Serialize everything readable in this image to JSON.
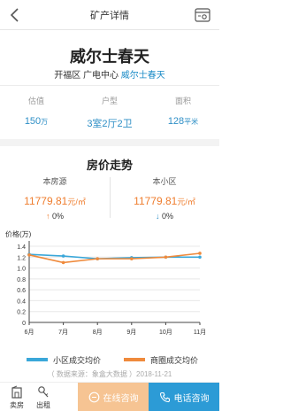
{
  "nav": {
    "title": "矿产详情"
  },
  "property": {
    "name": "威尔士春天",
    "location_prefix": "开福区 广电中心",
    "location_highlight": "威尔士春天"
  },
  "stats": [
    {
      "label": "估值",
      "value": "150",
      "unit": "万"
    },
    {
      "label": "户型",
      "value": "3室2厅2卫",
      "unit": ""
    },
    {
      "label": "面积",
      "value": "128",
      "unit": "平米"
    }
  ],
  "trend": {
    "title": "房价走势",
    "left": {
      "label": "本房源",
      "price": "11779.81",
      "unit": "元/㎡",
      "change": "0%",
      "direction": "up"
    },
    "right": {
      "label": "本小区",
      "price": "11779.81",
      "unit": "元/㎡",
      "change": "0%",
      "direction": "down"
    }
  },
  "chart_data": {
    "type": "line",
    "ylabel": "价格(万)",
    "x": [
      "6月",
      "7月",
      "8月",
      "9月",
      "10月",
      "11月"
    ],
    "ylim": [
      0,
      1.4
    ],
    "yticks": [
      "0",
      "0.2",
      "0.4",
      "0.6",
      "0.8",
      "1.0",
      "1.2",
      "1.4"
    ],
    "grid": true,
    "legend": "bottom",
    "series": [
      {
        "name": "小区成交均价",
        "color": "#3aa7d9",
        "values": [
          1.25,
          1.22,
          1.17,
          1.19,
          1.2,
          1.2
        ]
      },
      {
        "name": "商圈成交均价",
        "color": "#ef8a3c",
        "values": [
          1.24,
          1.1,
          1.17,
          1.17,
          1.2,
          1.27
        ]
      }
    ]
  },
  "source": "（ 数据来源：象盒大数据 ）2018-11-21",
  "bottom": {
    "tool1": "卖房",
    "tool2": "出租",
    "online": "在线咨询",
    "phone": "电话咨询"
  },
  "colors": {
    "accent": "#2c9bd6",
    "orange": "#ef7d2e",
    "online_button": "#f6c493"
  }
}
